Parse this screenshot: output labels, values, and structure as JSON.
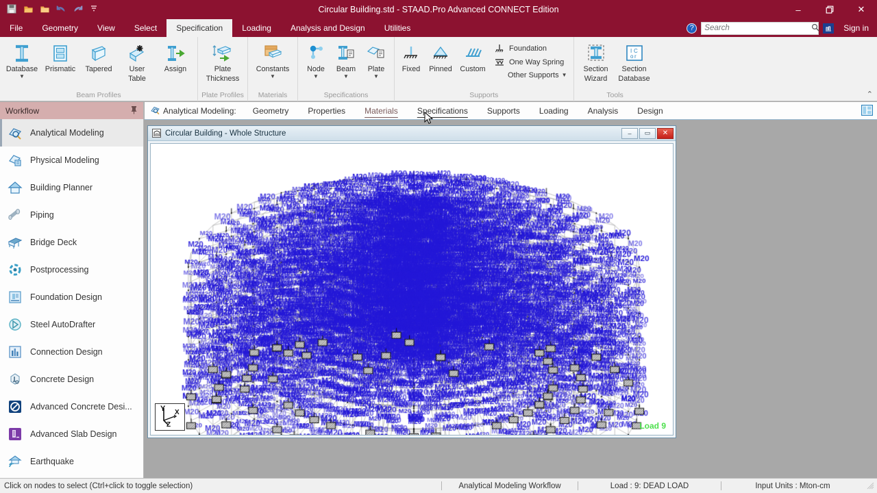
{
  "window": {
    "title": "Circular Building.std - STAAD.Pro Advanced CONNECT Edition",
    "minimize": "–",
    "restore": "❐",
    "close": "✕"
  },
  "quick_access": [
    {
      "name": "save-icon",
      "label": "Save"
    },
    {
      "name": "open-icon",
      "label": "Open"
    },
    {
      "name": "new-folder-icon",
      "label": "New"
    },
    {
      "name": "undo-icon",
      "label": "Undo"
    },
    {
      "name": "redo-icon",
      "label": "Redo"
    },
    {
      "name": "customize-qat-icon",
      "label": "Customize Quick Access Toolbar"
    }
  ],
  "menu": {
    "items": [
      {
        "label": "File",
        "active": false
      },
      {
        "label": "Geometry",
        "active": false
      },
      {
        "label": "View",
        "active": false
      },
      {
        "label": "Select",
        "active": false
      },
      {
        "label": "Specification",
        "active": true
      },
      {
        "label": "Loading",
        "active": false
      },
      {
        "label": "Analysis and Design",
        "active": false
      },
      {
        "label": "Utilities",
        "active": false
      }
    ],
    "help_glyph": "?",
    "bentley_glyph": "⚕",
    "sign_in": "Sign in"
  },
  "search": {
    "placeholder": "Search",
    "value": "",
    "icon": "search-icon"
  },
  "ribbon": {
    "collapse_glyph": "⌃",
    "groups": [
      {
        "label": "Beam Profiles",
        "buttons": [
          {
            "label": "Database",
            "icon": "i-beam-icon",
            "caret": true
          },
          {
            "label": "Prismatic",
            "icon": "prismatic-section-icon",
            "caret": false
          },
          {
            "label": "Tapered",
            "icon": "tapered-beam-icon",
            "caret": false
          },
          {
            "label": "User\nTable",
            "label1": "User",
            "label2": "Table",
            "icon": "user-table-icon",
            "caret": true
          },
          {
            "label": "Assign",
            "icon": "assign-arrow-icon",
            "caret": false
          }
        ]
      },
      {
        "label": "Plate Profiles",
        "buttons": [
          {
            "label1": "Plate",
            "label2": "Thickness",
            "icon": "plate-thickness-icon",
            "caret": false
          }
        ]
      },
      {
        "label": "Materials",
        "buttons": [
          {
            "label": "Constants",
            "icon": "constants-icon",
            "caret": true
          }
        ]
      },
      {
        "label": "Specifications",
        "buttons": [
          {
            "label": "Node",
            "icon": "node-spec-icon",
            "caret": true
          },
          {
            "label": "Beam",
            "icon": "beam-spec-icon",
            "caret": true
          },
          {
            "label": "Plate",
            "icon": "plate-spec-icon",
            "caret": true
          }
        ]
      },
      {
        "label": "Supports",
        "buttons": [
          {
            "label": "Fixed",
            "icon": "fixed-support-icon",
            "caret": false
          },
          {
            "label": "Pinned",
            "icon": "pinned-support-icon",
            "caret": false
          },
          {
            "label": "Custom",
            "icon": "custom-support-icon",
            "caret": false
          }
        ],
        "small_buttons": [
          {
            "label": "Foundation",
            "icon": "foundation-support-icon",
            "caret": false
          },
          {
            "label": "One Way Spring",
            "icon": "one-way-spring-icon",
            "caret": false
          },
          {
            "label": "Other Supports",
            "icon": "other-supports-icon",
            "caret": true
          }
        ]
      },
      {
        "label": "Tools",
        "buttons": [
          {
            "label1": "Section",
            "label2": "Wizard",
            "icon": "section-wizard-icon",
            "caret": false
          },
          {
            "label1": "Section",
            "label2": "Database",
            "icon": "section-database-icon",
            "caret": false
          }
        ]
      }
    ]
  },
  "sidebar": {
    "title": "Workflow",
    "pin_glyph": "📌",
    "items": [
      {
        "label": "Analytical Modeling",
        "icon": "analytical-modeling-icon",
        "active": true,
        "color": "#3d7fb5"
      },
      {
        "label": "Physical Modeling",
        "icon": "physical-modeling-icon",
        "active": false,
        "color": "#4a90c4"
      },
      {
        "label": "Building Planner",
        "icon": "building-planner-icon",
        "active": false,
        "color": "#5aa6d8"
      },
      {
        "label": "Piping",
        "icon": "piping-icon",
        "active": false,
        "color": "#9fb3c2"
      },
      {
        "label": "Bridge Deck",
        "icon": "bridge-deck-icon",
        "active": false,
        "color": "#6ea9cc"
      },
      {
        "label": "Postprocessing",
        "icon": "postprocessing-icon",
        "active": false,
        "color": "#3aa0c8"
      },
      {
        "label": "Foundation Design",
        "icon": "foundation-design-icon",
        "active": false,
        "color": "#5f9fcc"
      },
      {
        "label": "Steel AutoDrafter",
        "icon": "steel-autodrafter-icon",
        "active": false,
        "color": "#56b0c4"
      },
      {
        "label": "Connection Design",
        "icon": "connection-design-icon",
        "active": false,
        "color": "#5b93c7"
      },
      {
        "label": "Concrete Design",
        "icon": "concrete-design-icon",
        "active": false,
        "color": "#7fa4bd"
      },
      {
        "label": "Advanced Concrete Desi...",
        "icon": "advanced-concrete-design-icon",
        "active": false,
        "color": "#12437e"
      },
      {
        "label": "Advanced Slab Design",
        "icon": "advanced-slab-design-icon",
        "active": false,
        "color": "#7c3ba8"
      },
      {
        "label": "Earthquake",
        "icon": "earthquake-icon",
        "active": false,
        "color": "#3f9ac4"
      }
    ]
  },
  "doctabs": {
    "workflow_label": "Analytical Modeling:",
    "workflow_icon": "analytical-modeling-icon",
    "items": [
      {
        "label": "Geometry",
        "state": "normal"
      },
      {
        "label": "Properties",
        "state": "normal"
      },
      {
        "label": "Materials",
        "state": "highlight"
      },
      {
        "label": "Specifications",
        "state": "hover"
      },
      {
        "label": "Supports",
        "state": "normal"
      },
      {
        "label": "Loading",
        "state": "normal"
      },
      {
        "label": "Analysis",
        "state": "normal"
      },
      {
        "label": "Design",
        "state": "normal"
      }
    ],
    "panel_toggle_icon": "panel-layout-icon"
  },
  "mdi": {
    "title": "Circular Building - Whole Structure",
    "title_icon": "structure-window-icon",
    "minimize": "–",
    "maximize": "▭",
    "close": "✕"
  },
  "viewport": {
    "axis": {
      "x": "X",
      "y": "Y",
      "z": "Z"
    },
    "load_label": "Load 9",
    "load_color": "#4ee04e",
    "member_label": "M20",
    "member_label_color": "#2418d8",
    "member_line_color": "#9a9a9a"
  },
  "statusbar": {
    "message": "Click on nodes to select (Ctrl+click to toggle selection)",
    "workflow": "Analytical Modeling Workflow",
    "load": "Load : 9: DEAD LOAD",
    "units": "Input Units : Mton-cm"
  },
  "colors": {
    "brand_red": "#8c1230",
    "ribbon_bg": "#f1f1f1",
    "sidebar_header": "#d5aeae",
    "canvas_bg": "#ffffff",
    "workspace_bg": "#a8a8a8"
  }
}
